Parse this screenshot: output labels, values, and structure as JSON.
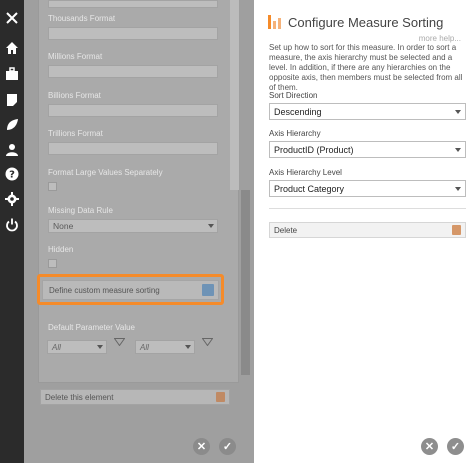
{
  "nav": {
    "icons": [
      "home-icon",
      "briefcase-icon",
      "note-icon",
      "leaf-icon",
      "user-icon",
      "help-icon",
      "settings-icon",
      "power-icon"
    ]
  },
  "properties_panel": {
    "thousands_format_label": "Thousands Format",
    "millions_format_label": "Millions Format",
    "billions_format_label": "Billions Format",
    "trillions_format_label": "Trillions Format",
    "format_large_values_label": "Format Large Values Separately",
    "missing_data_rule_label": "Missing Data Rule",
    "missing_data_rule_value": "None",
    "hidden_label": "Hidden",
    "define_custom_sorting_label": "Define custom measure sorting",
    "default_parameter_label": "Default Parameter Value",
    "param_select_1_value": "All",
    "param_select_2_value": "All",
    "delete_element_label": "Delete this element"
  },
  "configure_panel": {
    "title": "Configure Measure Sorting",
    "help_link": "more help...",
    "description": "Set up how to sort for this measure. In order to sort a measure, the axis hierarchy must be selected and a level. In addition, if there are any hierarchies on the opposite axis, then members must be selected from all of them.",
    "sort_direction_label": "Sort Direction",
    "sort_direction_value": "Descending",
    "axis_hierarchy_label": "Axis Hierarchy",
    "axis_hierarchy_value": "ProductID (Product)",
    "axis_hierarchy_level_label": "Axis Hierarchy Level",
    "axis_hierarchy_level_value": "Product Category",
    "delete_label": "Delete"
  },
  "colors": {
    "highlight": "#f58b2a",
    "cancel_btn": "#8e8e8e",
    "ok_btn": "#8e8e8e"
  }
}
